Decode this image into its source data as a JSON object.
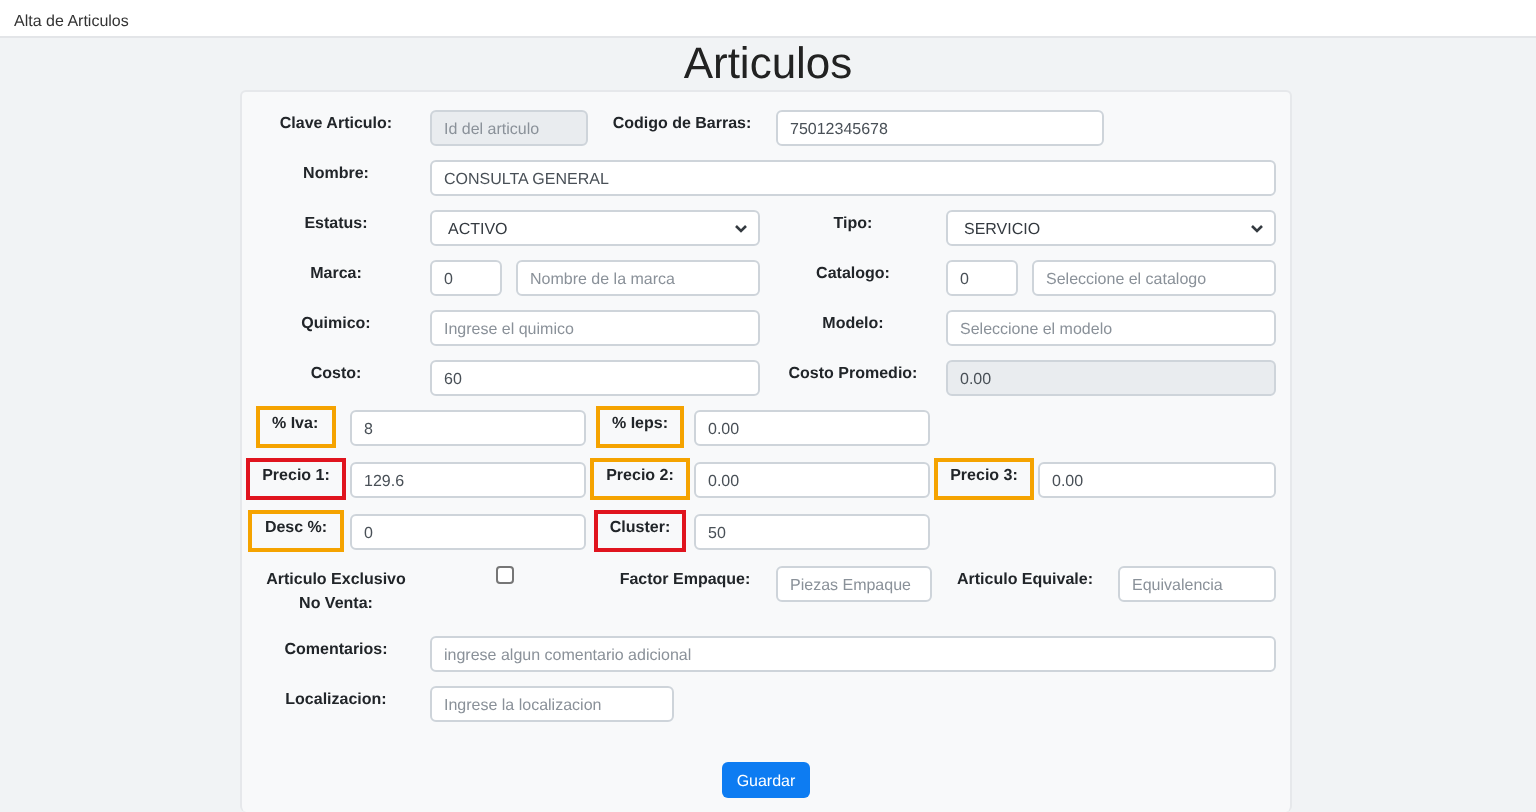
{
  "app_bar": {
    "title": "Alta de Articulos"
  },
  "heading": "Articulos",
  "form": {
    "rows": [
      {
        "kind": "split",
        "fields": [
          {
            "label": "Clave Articulo:",
            "controls": [
              {
                "kind": "input",
                "placeholder": "Id del articulo",
                "disabled": true
              }
            ]
          },
          {
            "label": "Codigo de Barras:",
            "controls": [
              {
                "kind": "input",
                "value": "75012345678",
                "disabled": false
              }
            ]
          }
        ]
      },
      {
        "kind": "full",
        "fields": [
          {
            "label": "Nombre:",
            "controls": [
              {
                "kind": "input",
                "value": "CONSULTA GENERAL",
                "disabled": false
              }
            ]
          }
        ]
      },
      {
        "kind": "half",
        "fields": [
          {
            "label": "Estatus:",
            "controls": [
              {
                "kind": "select",
                "value": "ACTIVO"
              }
            ]
          },
          {
            "label": "Tipo:",
            "controls": [
              {
                "kind": "select",
                "value": "SERVICIO"
              }
            ]
          }
        ]
      },
      {
        "kind": "half",
        "fields": [
          {
            "label": "Marca:",
            "controls": [
              {
                "kind": "short-input",
                "value": "0",
                "disabled": false
              },
              {
                "kind": "input",
                "placeholder": "Nombre de la marca",
                "disabled": false
              }
            ]
          },
          {
            "label": "Catalogo:",
            "controls": [
              {
                "kind": "short-input",
                "value": "0",
                "disabled": false
              },
              {
                "kind": "input",
                "placeholder": "Seleccione el catalogo",
                "disabled": false
              }
            ]
          }
        ]
      },
      {
        "kind": "half",
        "fields": [
          {
            "label": "Quimico:",
            "controls": [
              {
                "kind": "input",
                "placeholder": "Ingrese el quimico",
                "disabled": false
              }
            ]
          },
          {
            "label": "Modelo:",
            "controls": [
              {
                "kind": "input",
                "placeholder": "Seleccione el modelo",
                "disabled": false
              }
            ]
          }
        ]
      },
      {
        "kind": "half",
        "fields": [
          {
            "label": "Costo:",
            "controls": [
              {
                "kind": "input",
                "value": "60",
                "disabled": false
              }
            ]
          },
          {
            "label": "Costo Promedio:",
            "controls": [
              {
                "kind": "input",
                "value": "0.00",
                "disabled": true
              }
            ]
          }
        ]
      },
      {
        "kind": "thirds",
        "fields": [
          {
            "label": "% Iva:",
            "color": "#f5a300",
            "controls": [
              {
                "kind": "input",
                "value": "8",
                "disabled": false
              }
            ]
          },
          {
            "label": "% Ieps:",
            "color": "#f5a300",
            "controls": [
              {
                "kind": "input",
                "value": "0.00",
                "disabled": false
              }
            ]
          }
        ]
      },
      {
        "kind": "thirds",
        "fields": [
          {
            "label": "Precio 1:",
            "color": "#e0141e",
            "controls": [
              {
                "kind": "input",
                "value": "129.6",
                "disabled": false
              }
            ]
          },
          {
            "label": "Precio 2:",
            "color": "#f5a300",
            "controls": [
              {
                "kind": "input",
                "value": "0.00",
                "disabled": false
              }
            ]
          },
          {
            "label": "Precio 3:",
            "color": "#f5a300",
            "controls": [
              {
                "kind": "input",
                "value": "0.00",
                "disabled": false
              }
            ]
          }
        ]
      },
      {
        "kind": "thirds",
        "fields": [
          {
            "label": "Desc %:",
            "color": "#f5a300",
            "controls": [
              {
                "kind": "input",
                "value": "0",
                "disabled": false
              }
            ]
          },
          {
            "label": "Cluster:",
            "color": "#e0141e",
            "controls": [
              {
                "kind": "input",
                "value": "50",
                "disabled": false
              }
            ]
          }
        ]
      },
      {
        "kind": "quad",
        "fields": [
          {
            "label": "Articulo Exclusivo No Venta:",
            "controls": [
              {
                "kind": "checkbox",
                "checked": false
              }
            ]
          },
          {
            "label": "Factor Empaque:",
            "controls": [
              {
                "kind": "input",
                "placeholder": "Piezas Empaque",
                "disabled": false
              }
            ]
          },
          {
            "label": "Articulo Equivale:",
            "controls": [
              {
                "kind": "input",
                "placeholder": "Equivalencia",
                "disabled": false
              }
            ]
          }
        ]
      },
      {
        "kind": "full",
        "fields": [
          {
            "label": "Comentarios:",
            "controls": [
              {
                "kind": "input",
                "placeholder": "ingrese algun comentario adicional",
                "disabled": false
              }
            ]
          }
        ]
      },
      {
        "kind": "short",
        "fields": [
          {
            "label": "Localizacion:",
            "controls": [
              {
                "kind": "input",
                "placeholder": "Ingrese la localizacion",
                "disabled": false
              }
            ]
          }
        ]
      }
    ],
    "submit": "Guardar"
  }
}
